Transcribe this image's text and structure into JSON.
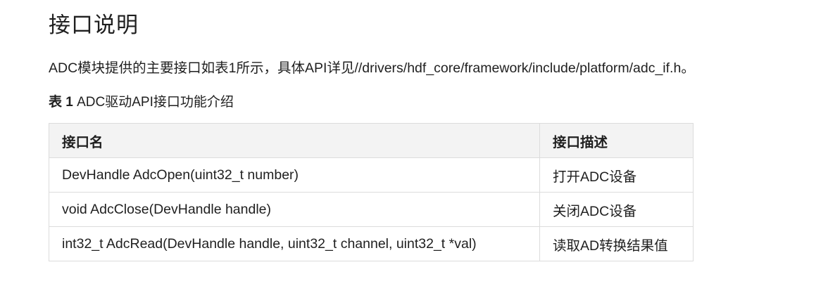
{
  "heading": "接口说明",
  "intro": "ADC模块提供的主要接口如表1所示，具体API详见//drivers/hdf_core/framework/include/platform/adc_if.h。",
  "caption": {
    "label": "表 1",
    "text": " ADC驱动API接口功能介绍"
  },
  "table": {
    "headers": [
      "接口名",
      "接口描述"
    ],
    "rows": [
      [
        "DevHandle AdcOpen(uint32_t number)",
        "打开ADC设备"
      ],
      [
        "void AdcClose(DevHandle handle)",
        "关闭ADC设备"
      ],
      [
        "int32_t AdcRead(DevHandle handle, uint32_t channel, uint32_t *val)",
        "读取AD转换结果值"
      ]
    ]
  },
  "colors": {
    "text": "#1f1f1f",
    "header_bg": "#f3f3f3",
    "border": "#dcdcdc"
  }
}
